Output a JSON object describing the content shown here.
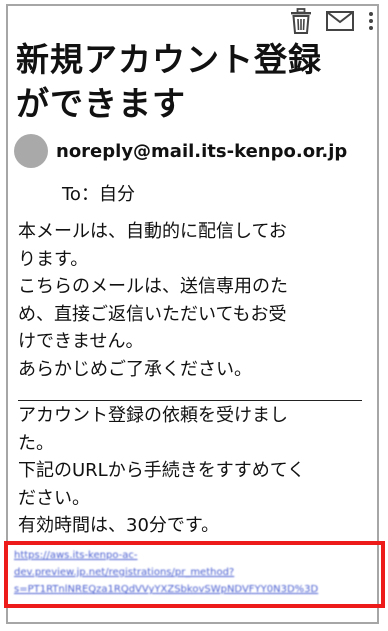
{
  "toolbar": {
    "icons": [
      "trash-icon",
      "mail-icon",
      "more-vertical-icon"
    ]
  },
  "email": {
    "subject_line1": "新規アカウント登録",
    "subject_line2": "ができます",
    "sender": "noreply@mail.its-kenpo.or.jp",
    "to_label": "To：",
    "to_value": "自分",
    "notice": [
      "本メールは、自動的に配信してお",
      "ります。",
      "こちらのメールは、送信専用のた",
      "め、直接ご返信いただいてもお受",
      "けできません。",
      "あらかじめご了承ください。"
    ],
    "body": [
      "アカウント登録の依頼を受けまし",
      "た。",
      "下記のURLから手続きをすすめてく",
      "ださい。",
      "有効時間は、30分です。"
    ],
    "link_lines": [
      "https://aws.its-kenpo-ac-",
      "dev.preview.jp.net/registrations/pr_method?",
      "s=PT1RTnlNREQza1RQdVVyYXZSbkovSWpNDVFYY0N3D%3D"
    ]
  },
  "colors": {
    "highlight_border": "#ee1b1b",
    "link": "#4a5fd0",
    "avatar": "#a9a9a9"
  }
}
